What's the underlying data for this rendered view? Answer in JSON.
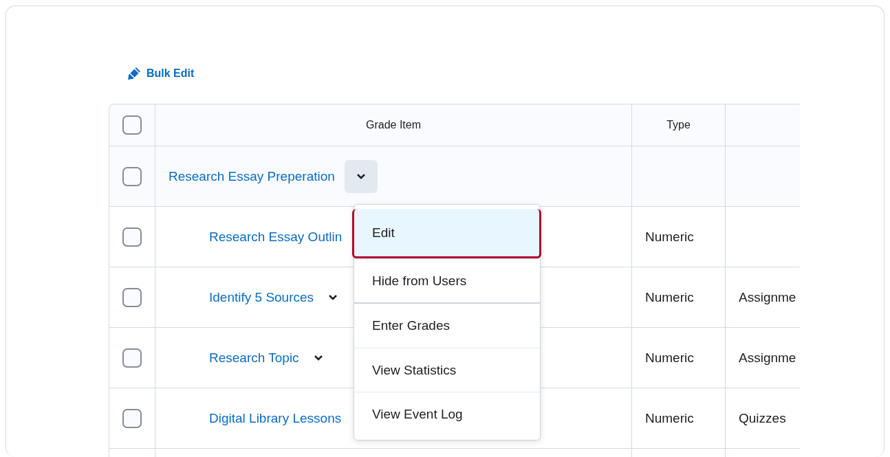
{
  "toolbar": {
    "bulk_edit": "Bulk Edit"
  },
  "table": {
    "header_checked": false,
    "columns": [
      "Grade Item",
      "Type"
    ],
    "rows": [
      {
        "name": "Research Essay Preperation",
        "checked": false,
        "menu_open": true,
        "children": [
          {
            "name": "Research Essay Outlin",
            "checked": false,
            "type": "Numeric"
          },
          {
            "name": "Identify 5 Sources",
            "checked": false,
            "type": "Numeric",
            "column_3": "Assignme"
          },
          {
            "name": "Research Topic",
            "checked": false,
            "type": "Numeric",
            "column_3": "Assignme"
          },
          {
            "name": "Digital Library Lessons",
            "checked": false,
            "type": "Numeric",
            "column_3": "Quizzes"
          }
        ]
      }
    ]
  },
  "menu": {
    "groups": [
      [
        {
          "label": "Edit",
          "selected": true
        },
        {
          "label": "Hide from Users",
          "selected": false
        }
      ],
      [
        {
          "label": "Enter Grades",
          "selected": false
        },
        {
          "label": "View Statistics",
          "selected": false
        },
        {
          "label": "View Event Log",
          "selected": false
        }
      ]
    ]
  }
}
